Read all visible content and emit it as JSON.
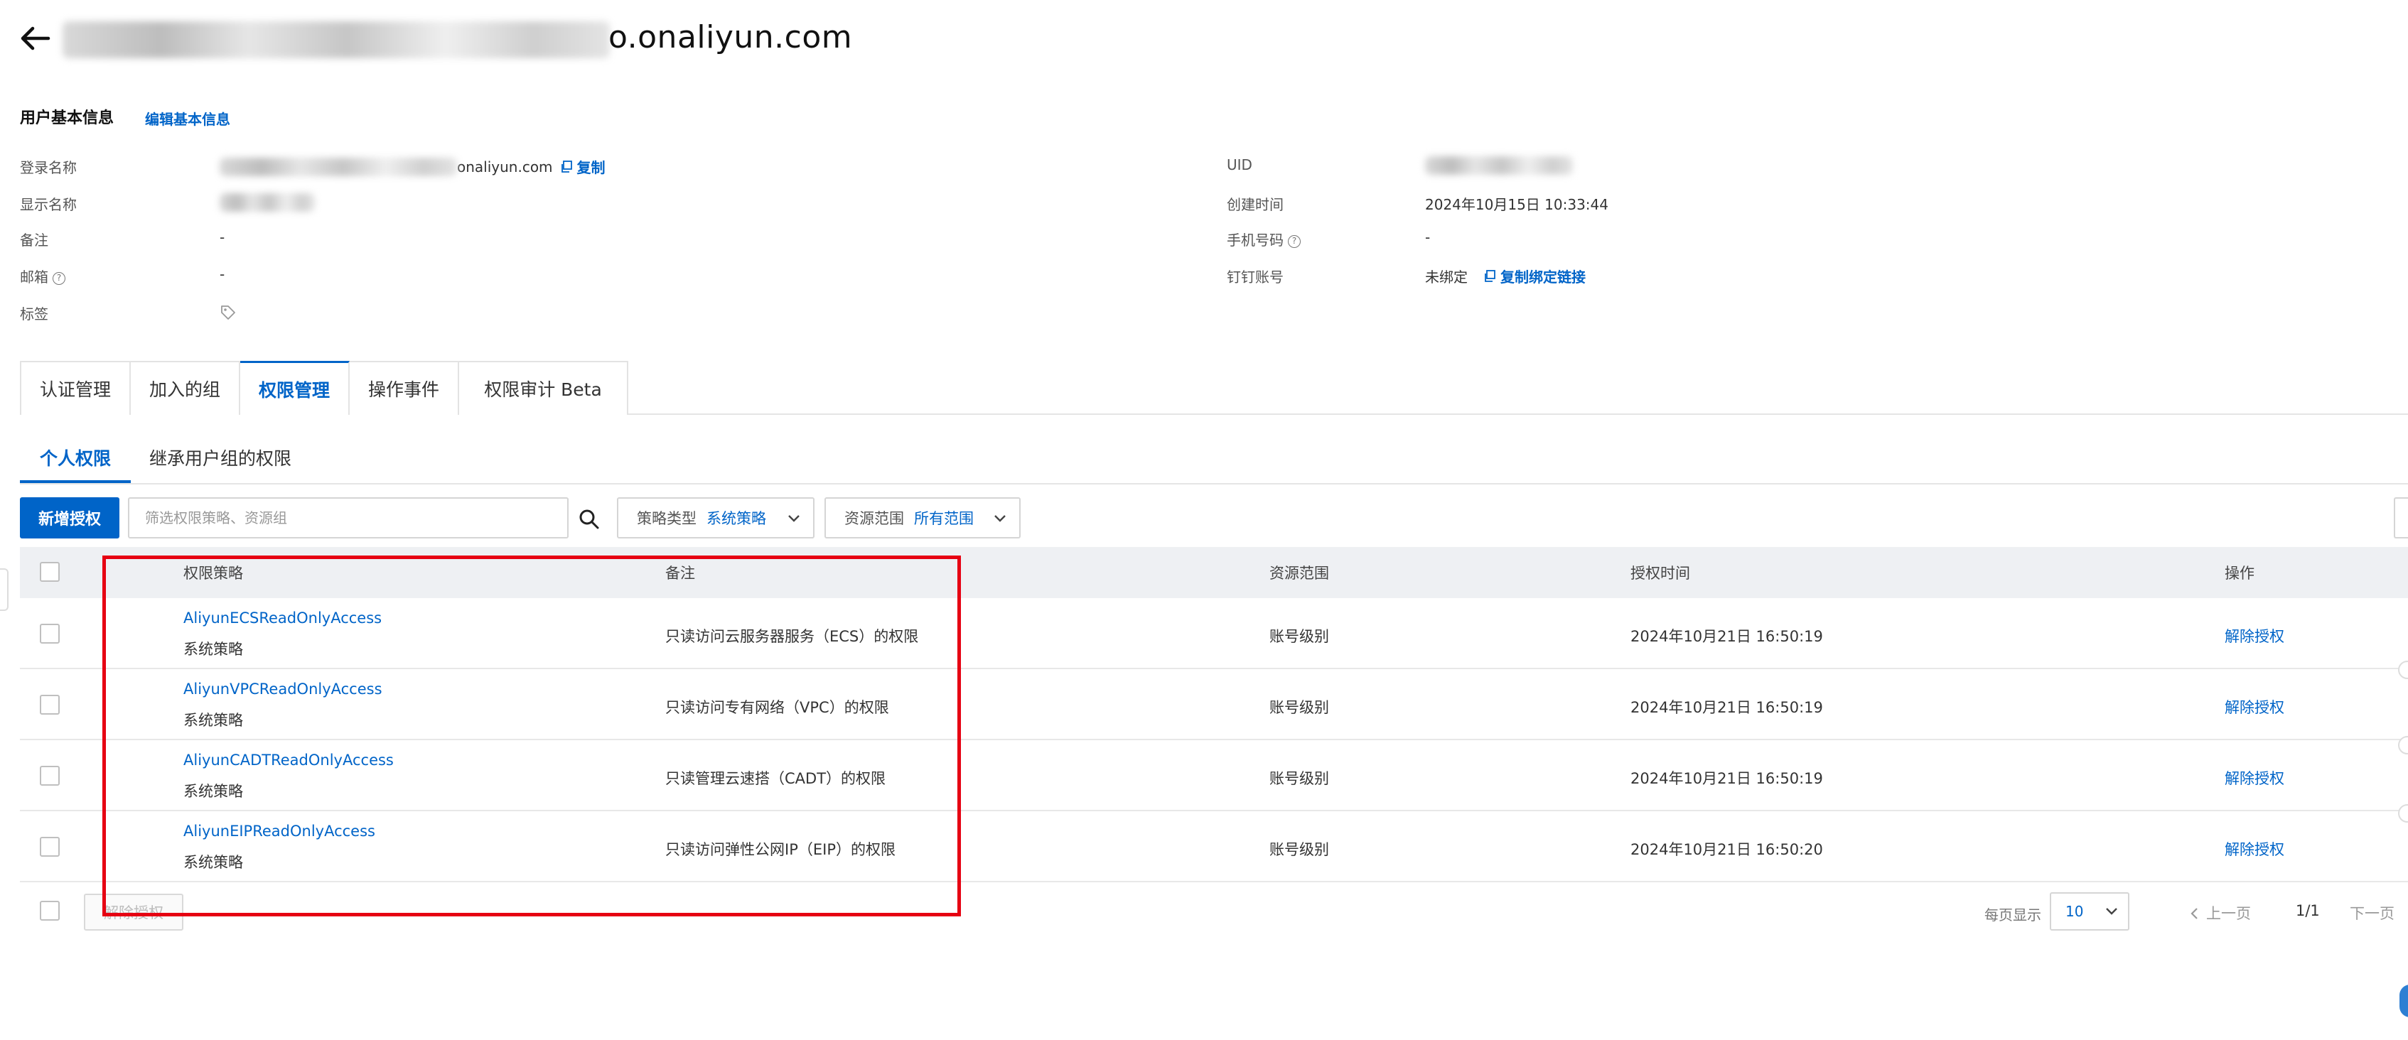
{
  "header": {
    "title_suffix": "o.onaliyun.com"
  },
  "basic_info": {
    "section_title": "用户基本信息",
    "edit_link": "编辑基本信息",
    "login_name_label": "登录名称",
    "login_name_suffix": "onaliyun.com",
    "copy_label": "复制",
    "display_name_label": "显示名称",
    "remark_label": "备注",
    "remark_value": "-",
    "email_label": "邮箱",
    "email_value": "-",
    "tag_label": "标签",
    "uid_label": "UID",
    "created_label": "创建时间",
    "created_value": "2024年10月15日 10:33:44",
    "phone_label": "手机号码",
    "phone_value": "-",
    "dingtalk_label": "钉钉账号",
    "dingtalk_value": "未绑定",
    "copy_bind_link": "复制绑定链接"
  },
  "tabs": [
    {
      "label": "认证管理"
    },
    {
      "label": "加入的组"
    },
    {
      "label": "权限管理"
    },
    {
      "label": "操作事件"
    },
    {
      "label": "权限审计 Beta"
    }
  ],
  "subtabs": {
    "personal": "个人权限",
    "inherited": "继承用户组的权限"
  },
  "toolbar": {
    "add_button": "新增授权",
    "search_placeholder": "筛选权限策略、资源组",
    "policy_type_label": "策略类型",
    "policy_type_value": "系统策略",
    "scope_label": "资源范围",
    "scope_value": "所有范围"
  },
  "table": {
    "headers": {
      "policy": "权限策略",
      "remark": "备注",
      "scope": "资源范围",
      "time": "授权时间",
      "action": "操作"
    },
    "rows": [
      {
        "name": "AliyunECSReadOnlyAccess",
        "type": "系统策略",
        "remark": "只读访问云服务器服务（ECS）的权限",
        "scope": "账号级别",
        "time": "2024年10月21日 16:50:19",
        "action": "解除授权"
      },
      {
        "name": "AliyunVPCReadOnlyAccess",
        "type": "系统策略",
        "remark": "只读访问专有网络（VPC）的权限",
        "scope": "账号级别",
        "time": "2024年10月21日 16:50:19",
        "action": "解除授权"
      },
      {
        "name": "AliyunCADTReadOnlyAccess",
        "type": "系统策略",
        "remark": "只读管理云速搭（CADT）的权限",
        "scope": "账号级别",
        "time": "2024年10月21日 16:50:19",
        "action": "解除授权"
      },
      {
        "name": "AliyunEIPReadOnlyAccess",
        "type": "系统策略",
        "remark": "只读访问弹性公网IP（EIP）的权限",
        "scope": "账号级别",
        "time": "2024年10月21日 16:50:20",
        "action": "解除授权"
      }
    ]
  },
  "footer": {
    "batch_revoke": "解除授权",
    "per_page_label": "每页显示",
    "per_page_value": "10",
    "prev": "上一页",
    "page": "1/1",
    "next": "下一页"
  },
  "colors": {
    "accent": "#0064c8",
    "highlight": "#e60012"
  }
}
